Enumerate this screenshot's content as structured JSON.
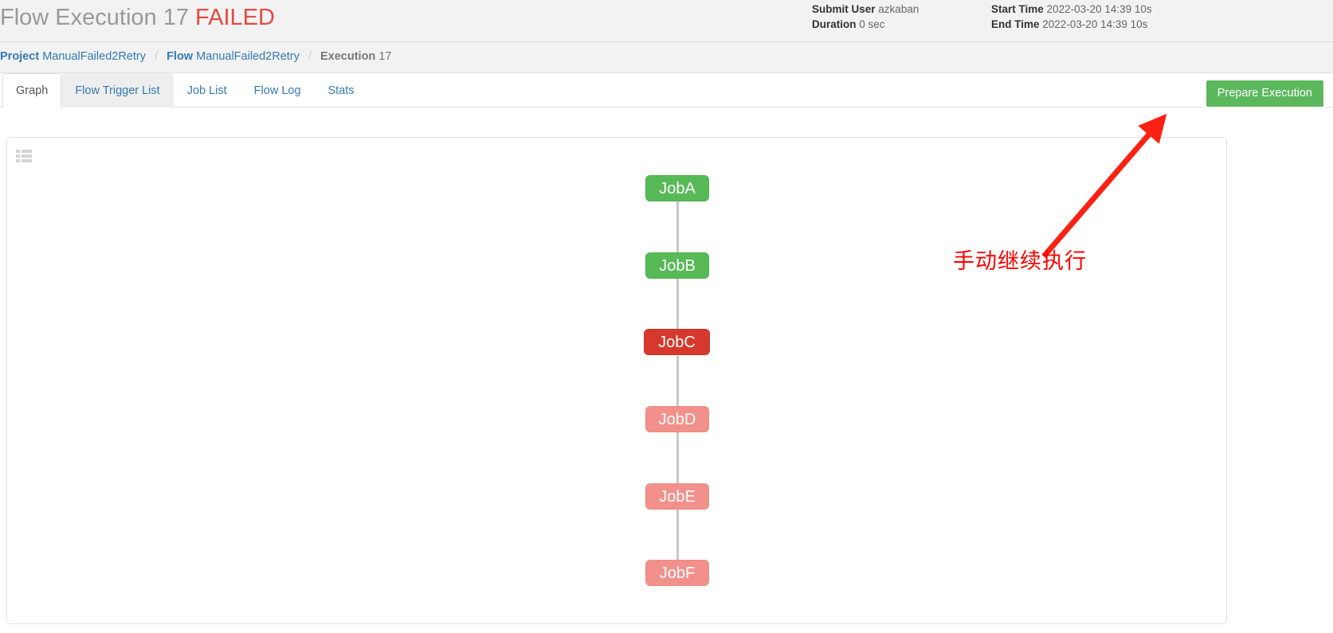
{
  "header": {
    "title_prefix": "Flow Execution 17",
    "status": "FAILED",
    "meta_left": [
      {
        "label": "Submit User",
        "value": "azkaban"
      },
      {
        "label": "Duration",
        "value": "0 sec"
      }
    ],
    "meta_right": [
      {
        "label": "Start Time",
        "value": "2022-03-20 14:39 10s"
      },
      {
        "label": "End Time",
        "value": "2022-03-20 14:39 10s"
      }
    ]
  },
  "breadcrumb": [
    {
      "label": "Project",
      "value": "ManualFailed2Retry"
    },
    {
      "label": "Flow",
      "value": "ManualFailed2Retry"
    },
    {
      "label": "Execution",
      "value": "17"
    }
  ],
  "breadcrumb_separator": "/",
  "tabs": [
    {
      "label": "Graph",
      "state": "active"
    },
    {
      "label": "Flow Trigger List",
      "state": "hovered"
    },
    {
      "label": "Job List",
      "state": "normal"
    },
    {
      "label": "Flow Log",
      "state": "normal"
    },
    {
      "label": "Stats",
      "state": "normal"
    }
  ],
  "actions": {
    "prepare_execution_label": "Prepare Execution"
  },
  "graph": {
    "toolbar_icon": "grid-list-icon",
    "nodes": [
      {
        "label": "JobA",
        "status": "succeeded"
      },
      {
        "label": "JobB",
        "status": "succeeded"
      },
      {
        "label": "JobC",
        "status": "failed"
      },
      {
        "label": "JobD",
        "status": "killed"
      },
      {
        "label": "JobE",
        "status": "killed"
      },
      {
        "label": "JobF",
        "status": "killed"
      }
    ]
  },
  "annotation": {
    "text": "手动继续执行",
    "arrow_color": "#fb2113",
    "text_color": "#ff0000"
  },
  "colors": {
    "succeeded": "#58b957",
    "failed": "#d6392c",
    "killed": "#f2918b",
    "link": "#337ab7",
    "status_failed_text": "#e24b41",
    "button_green": "#5cb85c"
  }
}
